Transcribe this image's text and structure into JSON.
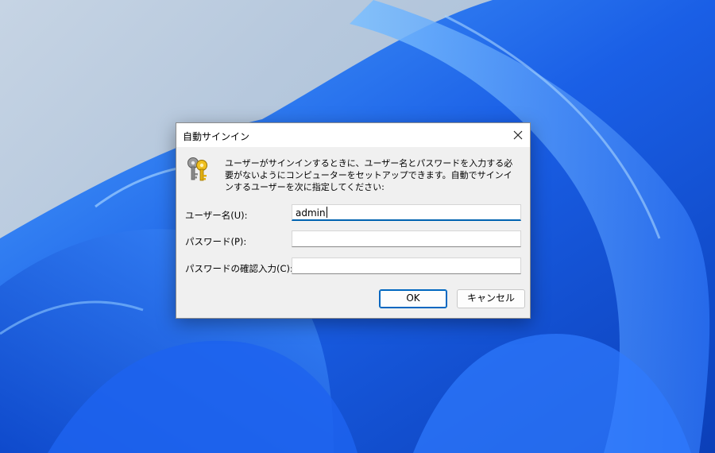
{
  "dialog": {
    "title": "自動サインイン",
    "description": "ユーザーがサインインするときに、ユーザー名とパスワードを入力する必要がないようにコンピューターをセットアップできます。自動でサインインするユーザーを次に指定してください:",
    "username_label": "ユーザー名(U):",
    "username_value": "admin",
    "password_label": "パスワード(P):",
    "password_value": "",
    "confirm_label": "パスワードの確認入力(C):",
    "confirm_value": "",
    "ok_label": "OK",
    "cancel_label": "キャンセル"
  },
  "icons": {
    "key": "key-icon",
    "close": "close-icon"
  },
  "colors": {
    "accent": "#0067c0",
    "dialog_bg": "#f0f0f0",
    "wallpaper_blue": "#1e6bf0"
  }
}
